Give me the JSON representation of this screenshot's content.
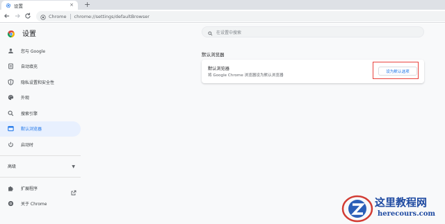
{
  "browser": {
    "tab": {
      "title": "设置",
      "close": "×",
      "icon": "settings-gear-icon"
    },
    "new_tab": "+",
    "omnibox": {
      "secure_label": "Chrome",
      "url": "chrome://settings/defaultBrowser"
    }
  },
  "settings": {
    "title": "设置",
    "search_placeholder": "在设置中搜索",
    "sidebar": {
      "items": [
        {
          "label": "您与 Google",
          "icon": "person-icon"
        },
        {
          "label": "自动填充",
          "icon": "clipboard-icon"
        },
        {
          "label": "隐私设置和安全性",
          "icon": "shield-icon"
        },
        {
          "label": "外观",
          "icon": "palette-icon"
        },
        {
          "label": "搜索引擎",
          "icon": "search-icon"
        },
        {
          "label": "默认浏览器",
          "icon": "browser-window-icon",
          "active": true
        },
        {
          "label": "启动时",
          "icon": "power-icon"
        }
      ],
      "advanced": "高级",
      "extensions": "扩展程序",
      "about": "关于 Chrome"
    },
    "section_title": "默认浏览器",
    "card": {
      "title": "默认浏览器",
      "subtitle": "将 Google Chrome 浏览器设为默认浏览器",
      "button": "设为默认选项"
    }
  },
  "watermark": {
    "line1": "这里教程网",
    "line2": "herecours.com"
  },
  "colors": {
    "accent": "#1a73e8",
    "highlight": "#e8413b",
    "active_bg": "#e8f0fe"
  }
}
